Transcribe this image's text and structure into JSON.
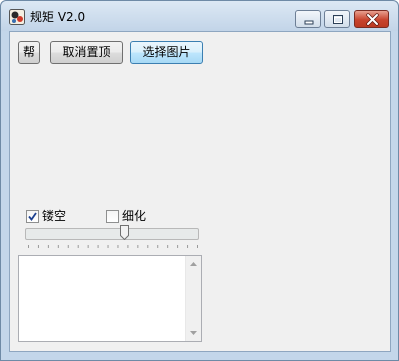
{
  "window": {
    "title": "规矩 V2.0",
    "controls": {
      "minimize": "minimize",
      "maximize": "maximize",
      "close": "close"
    }
  },
  "toolbar": {
    "help_label": "帮",
    "unpin_label": "取消置顶",
    "choose_image_label": "选择图片"
  },
  "options": {
    "hollow": {
      "label": "镂空",
      "checked": true
    },
    "thin": {
      "label": "细化",
      "checked": false
    }
  },
  "slider": {
    "value": 0.58
  },
  "output": {
    "text": ""
  },
  "colors": {
    "titlebar": "#c2d4e8",
    "close_button": "#c8442e",
    "focus_border": "#3c7fb1",
    "face": "#f0f0f0"
  }
}
